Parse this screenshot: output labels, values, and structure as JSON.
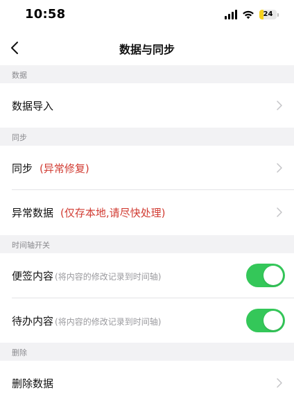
{
  "status_bar": {
    "time": "10:58",
    "battery": "24",
    "battery_level": 0.24
  },
  "nav": {
    "title": "数据与同步",
    "back_icon": "chevron-left-icon"
  },
  "sections": {
    "data": {
      "header": "数据",
      "rows": [
        {
          "label": "数据导入"
        }
      ]
    },
    "sync": {
      "header": "同步",
      "rows": [
        {
          "label": "同步",
          "note": "(异常修复)"
        },
        {
          "label": "异常数据",
          "note": "(仅存本地,请尽快处理)"
        }
      ]
    },
    "timeline": {
      "header": "时间轴开关",
      "rows": [
        {
          "label": "便签内容",
          "note": "(将内容的修改记录到时间轴)",
          "enabled": true
        },
        {
          "label": "待办内容",
          "note": "(将内容的修改记录到时间轴)",
          "enabled": true
        }
      ]
    },
    "delete": {
      "header": "删除",
      "rows": [
        {
          "label": "删除数据"
        }
      ]
    }
  },
  "colors": {
    "accent_green": "#34c759",
    "warning_red": "#d13b32",
    "section_bg": "#f2f2f4"
  }
}
